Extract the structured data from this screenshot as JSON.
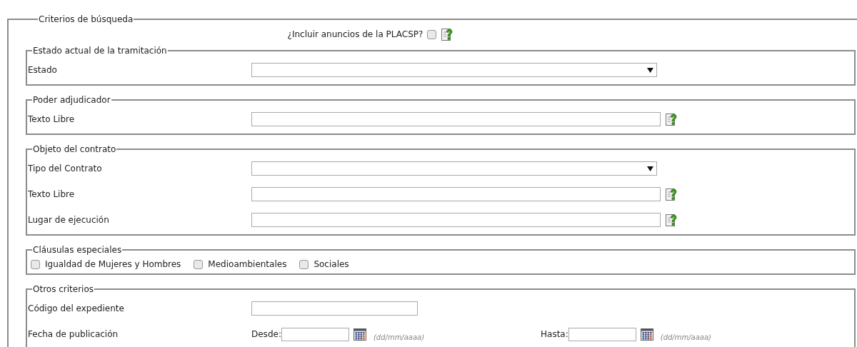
{
  "search_criteria": {
    "legend": "Criterios de búsqueda",
    "include_placsp": {
      "label": "¿Incluir anuncios de la PLACSP?",
      "checked": false
    },
    "sections": [
      {
        "legend": "Estado actual de la tramitación",
        "rows": [
          {
            "kind": "select",
            "label": "Estado"
          }
        ]
      },
      {
        "legend": "Poder adjudicador",
        "rows": [
          {
            "kind": "text",
            "label": "Texto Libre"
          }
        ]
      },
      {
        "legend": "Objeto del contrato",
        "rows": [
          {
            "kind": "select",
            "label": "Tipo del Contrato"
          },
          {
            "kind": "text",
            "label": "Texto Libre"
          },
          {
            "kind": "text",
            "label": "Lugar de ejecución"
          }
        ]
      },
      {
        "legend": "Cláusulas especiales",
        "rows": [
          {
            "kind": "checkboxes",
            "options": [
              {
                "label": "Igualdad de Mujeres y Hombres",
                "checked": false
              },
              {
                "label": "Medioambientales",
                "checked": false
              },
              {
                "label": "Sociales",
                "checked": false
              }
            ]
          }
        ]
      },
      {
        "legend": "Otros criterios",
        "rows": [
          {
            "kind": "short_text",
            "label": "Código del expediente"
          },
          {
            "kind": "date_range",
            "label": "Fecha de publicación",
            "from": {
              "label": "Desde:",
              "hint": "(dd/mm/aaaa)"
            },
            "to": {
              "label": "Hasta:",
              "hint": "(dd/mm/aaaa)"
            }
          }
        ]
      }
    ]
  }
}
